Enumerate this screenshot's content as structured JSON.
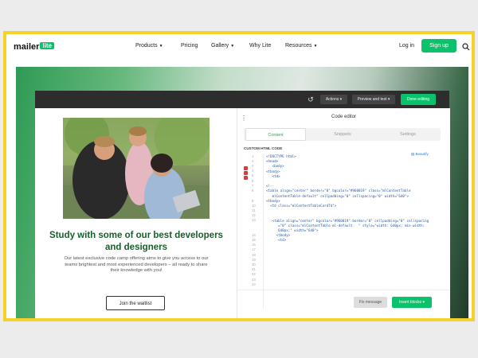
{
  "nav": {
    "logo": "mailer",
    "logo_badge": "lite",
    "links": [
      "Products",
      "Pricing",
      "Gallery",
      "Why Lite",
      "Resources"
    ],
    "login": "Log in",
    "signup": "Sign up",
    "search_icon": "search-icon"
  },
  "editor": {
    "toolbar": {
      "undo_icon": "undo-icon",
      "actions": "Actions",
      "preview": "Preview and test",
      "done": "Done editing"
    },
    "preview": {
      "headline": "Study with some of our best developers and designers",
      "body": "Our latest exclusive code camp offering aims to give you access to our teams brightest and most experienced developers – all ready to share their knowledge with you!",
      "button": "Join the waitlist"
    },
    "panel": {
      "title": "Code editor",
      "tabs": [
        "Content",
        "Snippets",
        "Settings"
      ],
      "code_label": "CUSTOM HTML CODE",
      "beautify": "Beautify",
      "line_numbers": [
        "1",
        "2",
        "3",
        "4",
        "5",
        "6",
        "7",
        "8",
        "9",
        "10",
        "11",
        "12",
        "13",
        "14",
        "15",
        "16",
        "17",
        "18",
        "19",
        "20",
        "21",
        "22",
        "23",
        "24"
      ],
      "code": "<!DOCTYPE html>\n<head>\n   <body>\n<tbody>\n   <td>\n\n<!--\n<table align=\"center\" border=\"0\" bgcolor=\"#960019\" class=\"mlContentTable\n   mlContentTable-default\" cellpadding=\"0\" cellspacing=\"0\" width=\"640\">\n<tbody>\n  <td class=\"mlContentTableCardTd\">\n\n\n   <table align=\"center\" bgcolor=\"#960019\" border=\"0\" cellpadding=\"0\" cellspacing\n      =\"0\" class=\"mlContentTable ml-default   \" style=\"width: 640px; min-width:\n      640px;\" width=\"640\">\n     <tbody>\n      <td>\n\n\n\n",
      "fix_button": "Fix message",
      "insert_button": "Insert blocks"
    }
  }
}
